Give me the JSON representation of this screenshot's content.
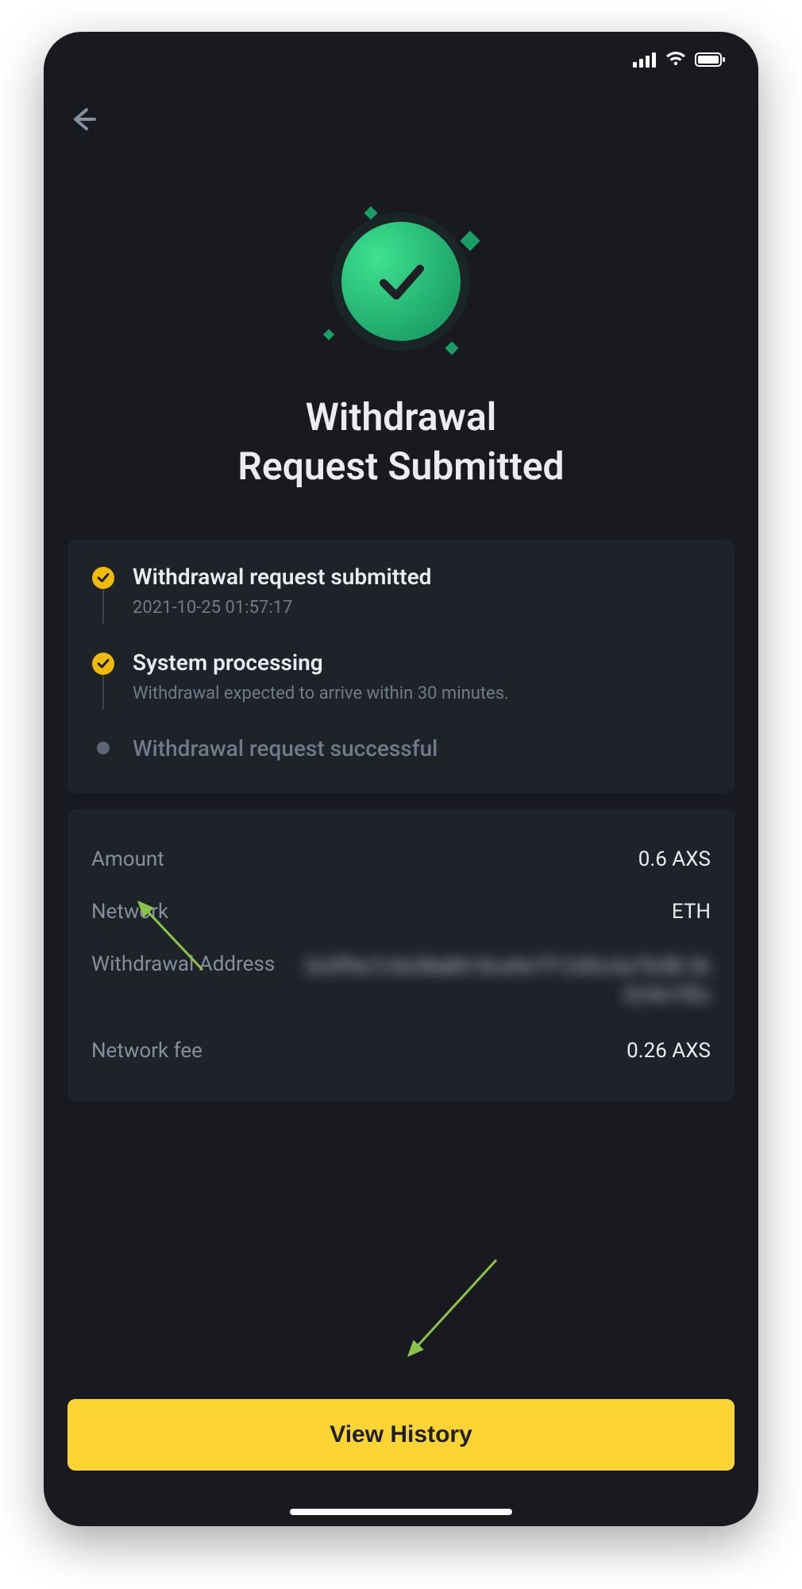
{
  "title_line1": "Withdrawal",
  "title_line2": "Request Submitted",
  "steps": {
    "s1": {
      "title": "Withdrawal request submitted",
      "sub": "2021-10-25 01:57:17"
    },
    "s2": {
      "title": "System processing",
      "sub": "Withdrawal expected to arrive within 30 minutes."
    },
    "s3": {
      "title": "Withdrawal request successful"
    }
  },
  "details": {
    "amount_label": "Amount",
    "amount_value": "0.6 AXS",
    "network_label": "Network",
    "network_value": "ETH",
    "address_label": "Withdrawal Address",
    "address_value": "0x5f9a7c5e38aB4 8ca9e7f12d3cAa7b3B 2b0c9e1f0c",
    "fee_label": "Network fee",
    "fee_value": "0.26 AXS"
  },
  "button": {
    "view_history": "View History"
  }
}
